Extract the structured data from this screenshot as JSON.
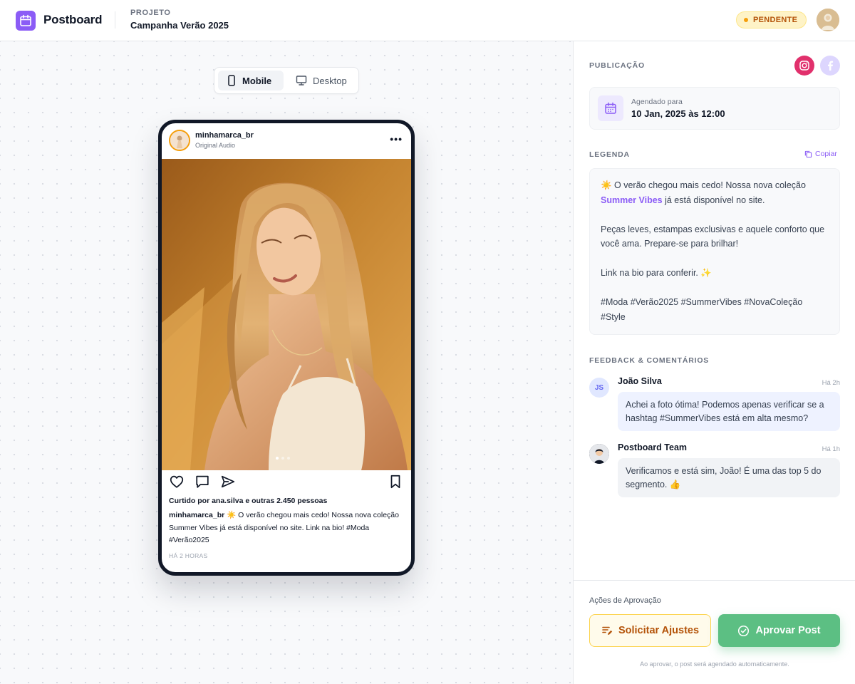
{
  "header": {
    "brand": "Postboard",
    "project_label": "PROJETO",
    "project_name": "Campanha Verão 2025",
    "status": "PENDENTE"
  },
  "preview": {
    "toggle": {
      "mobile": "Mobile",
      "desktop": "Desktop",
      "active": "Mobile"
    },
    "post": {
      "username": "minhamarca_br",
      "subtitle": "Original Audio",
      "more": "•••",
      "likes": "Curtido por ana.silva e outras 2.450 pessoas",
      "caption_user": "minhamarca_br",
      "caption_text": " ☀️ O verão chegou mais cedo! Nossa nova coleção Summer Vibes já está disponível no site. Link na bio! #Moda #Verão2025",
      "time_ago": "HÁ 2 HORAS",
      "carousel": {
        "count": 3,
        "active_index": 0
      }
    }
  },
  "panel": {
    "publication": {
      "title": "PUBLICAÇÃO",
      "schedule_label": "Agendado para",
      "schedule_value": "10 Jan, 2025 às 12:00",
      "networks": [
        "instagram-icon",
        "facebook-icon"
      ]
    },
    "caption": {
      "title": "LEGENDA",
      "copy_label": "Copiar",
      "p1_before": "☀️ O verão chegou mais cedo! Nossa nova coleção ",
      "p1_highlight": "Summer Vibes",
      "p1_after": " já está disponível no site.",
      "p2": "Peças leves, estampas exclusivas e aquele conforto que você ama. Prepare-se para brilhar!",
      "p3": "Link na bio para conferir. ✨",
      "p4": "#Moda #Verão2025 #SummerVibes #NovaColeção #Style"
    },
    "feedback": {
      "title": "FEEDBACK & COMENTÁRIOS",
      "comments": [
        {
          "initials": "JS",
          "name": "João Silva",
          "time": "Há 2h",
          "text": "Achei a foto ótima! Podemos apenas verificar se a hashtag #SummerVibes está em alta mesmo?"
        },
        {
          "initials": "",
          "name": "Postboard Team",
          "time": "Há 1h",
          "text": "Verificamos e está sim, João! É uma das top 5 do segmento. 👍"
        }
      ]
    },
    "approval": {
      "title": "Ações de Aprovação",
      "request_label": "Solicitar Ajustes",
      "approve_label": "Aprovar Post",
      "note": "Ao aprovar, o post será agendado automaticamente."
    }
  },
  "colors": {
    "accent": "#8b5cf6",
    "approve": "#5cbf83",
    "pending_bg": "#fef3c7",
    "pending_text": "#b45309",
    "instagram": "#e1306c",
    "facebook_bg": "#ddd6fe"
  }
}
